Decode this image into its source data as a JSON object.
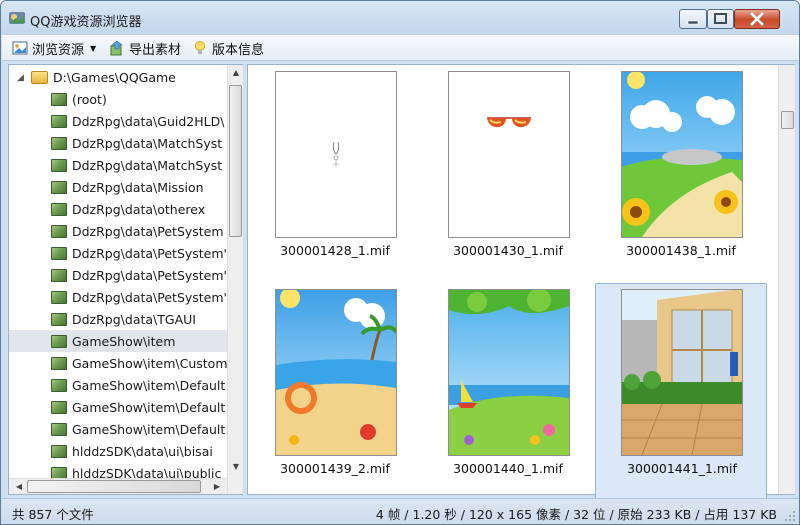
{
  "window": {
    "title": "QQ游戏资源浏览器"
  },
  "toolbar": {
    "browse_label": "浏览资源",
    "export_label": "导出素材",
    "version_label": "版本信息"
  },
  "tree": {
    "root": "D:\\Games\\QQGame",
    "items": [
      "(root)",
      "DdzRpg\\data\\Guid2HLD\\",
      "DdzRpg\\data\\MatchSyst",
      "DdzRpg\\data\\MatchSyst",
      "DdzRpg\\data\\Mission",
      "DdzRpg\\data\\otherex",
      "DdzRpg\\data\\PetSystem",
      "DdzRpg\\data\\PetSystem'",
      "DdzRpg\\data\\PetSystem'",
      "DdzRpg\\data\\PetSystem'",
      "DdzRpg\\data\\TGAUI",
      "GameShow\\item",
      "GameShow\\item\\Custom",
      "GameShow\\item\\Default",
      "GameShow\\item\\Default",
      "GameShow\\item\\Default",
      "hlddzSDK\\data\\ui\\bisai",
      "hlddzSDK\\data\\ui\\public"
    ],
    "selected_index": 11
  },
  "thumbnails": [
    {
      "name": "300001428_1.mif",
      "icon": "sparkle-sprite"
    },
    {
      "name": "300001430_1.mif",
      "icon": "sunglasses-sprite"
    },
    {
      "name": "300001438_1.mif",
      "icon": "sunflower-beach-scene"
    },
    {
      "name": "300001439_2.mif",
      "icon": "beach-lifebuoy-crab-scene"
    },
    {
      "name": "300001440_1.mif",
      "icon": "sailboat-meadow-scene"
    },
    {
      "name": "300001441_1.mif",
      "icon": "glass-building-scene"
    }
  ],
  "selected_thumbnail": 5,
  "status": {
    "left": "共 857 个文件",
    "right": "4 帧 / 1.20 秒 / 120 x 165 像素 / 32 位 / 原始 233 KB / 占用 137 KB"
  },
  "colors": {
    "selection": "#dbe8f7",
    "selection_border": "#8eb4de",
    "close_button": "#c8492a"
  }
}
